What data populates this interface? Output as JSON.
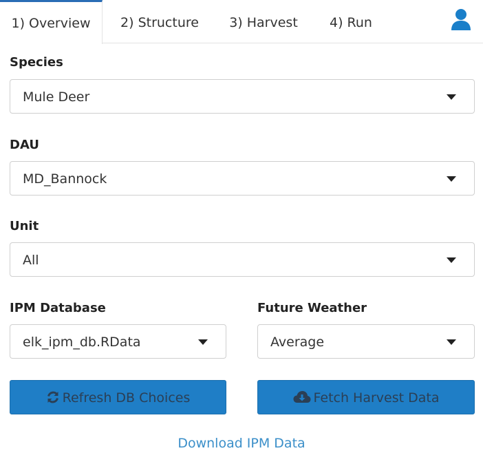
{
  "tabs": [
    {
      "label": "1) Overview",
      "active": true
    },
    {
      "label": "2) Structure",
      "active": false
    },
    {
      "label": "3) Harvest",
      "active": false
    },
    {
      "label": "4) Run",
      "active": false
    }
  ],
  "user_icon": "user-icon",
  "species": {
    "label": "Species",
    "value": "Mule Deer"
  },
  "dau": {
    "label": "DAU",
    "value": "MD_Bannock"
  },
  "unit": {
    "label": "Unit",
    "value": "All"
  },
  "ipm_database": {
    "label": "IPM Database",
    "value": "elk_ipm_db.RData"
  },
  "future_weather": {
    "label": "Future Weather",
    "value": "Average"
  },
  "refresh_button": {
    "label": "Refresh DB Choices",
    "icon": "refresh-icon"
  },
  "fetch_button": {
    "label": "Fetch Harvest Data",
    "icon": "cloud-download-icon"
  },
  "download_link": {
    "label": "Download IPM Data"
  },
  "colors": {
    "accent": "#2a6db5",
    "button": "#1f7ec6",
    "link": "#3b8fc9"
  }
}
